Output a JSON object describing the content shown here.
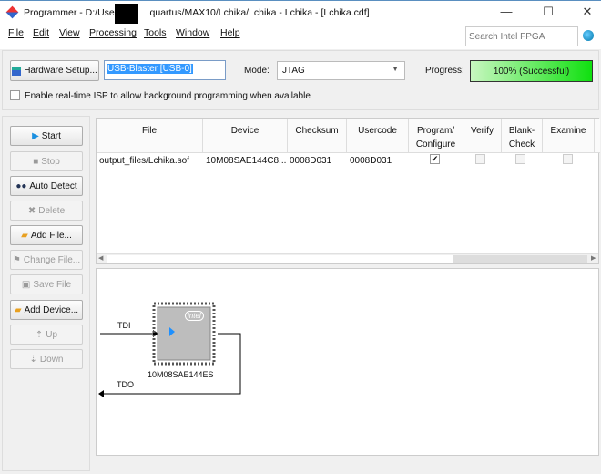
{
  "window": {
    "title": "Programmer - D:/Users",
    "title_rest": "quartus/MAX10/Lchika/Lchika - Lchika - [Lchika.cdf]",
    "minimize": "—",
    "maximize": "☐",
    "close": "✕"
  },
  "menu": [
    "File",
    "Edit",
    "View",
    "Processing",
    "Tools",
    "Window",
    "Help"
  ],
  "search": {
    "placeholder": "Search Intel FPGA"
  },
  "toolbar": {
    "hardware_setup": "Hardware Setup...",
    "hardware": "USB-Blaster [USB-0]",
    "mode_label": "Mode:",
    "mode": "JTAG",
    "progress_label": "Progress:",
    "progress": "100% (Successful)",
    "progress_value": 100,
    "isp_label": "Enable real-time ISP to allow background programming when available"
  },
  "buttons": [
    "Start",
    "Stop",
    "Auto Detect",
    "Delete",
    "Add File...",
    "Change File...",
    "Save File",
    "Add Device...",
    "Up",
    "Down"
  ],
  "table": {
    "headers": [
      "File",
      "Device",
      "Checksum",
      "Usercode",
      "Program/\nConfigure",
      "Verify",
      "Blank-\nCheck",
      "Examine"
    ],
    "rows": [
      {
        "file": "output_files/Lchika.sof",
        "device": "10M08SAE144C8...",
        "checksum": "0008D031",
        "usercode": "0008D031",
        "program": true,
        "verify": false,
        "blank_check": false,
        "examine": false
      }
    ]
  },
  "diagram": {
    "tdi": "TDI",
    "tdo": "TDO",
    "device": "10M08SAE144ES",
    "chip_logo": "intel"
  }
}
